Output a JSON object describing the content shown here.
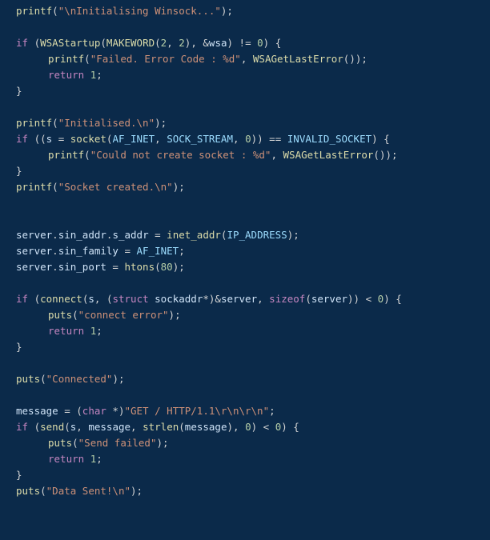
{
  "colors": {
    "background": "#0b2a4a",
    "keyword": "#c586c0",
    "function": "#dcdcaa",
    "macro": "#9cdcfe",
    "string": "#ce9178",
    "number": "#b5cea8",
    "identifier": "#cfe3f7",
    "punct": "#d4d4d4"
  },
  "t": {
    "printf": "printf",
    "if": "if",
    "return": "return",
    "return_sp": "return ",
    "sizeof": "sizeof",
    "struct": "struct",
    "char": "char",
    "puts": "puts",
    "WSAStartup": "WSAStartup",
    "MAKEWORD": "MAKEWORD",
    "WSAGetLastError": "WSAGetLastError",
    "socket": "socket",
    "AF_INET": "AF_INET",
    "SOCK_STREAM": "SOCK_STREAM",
    "INVALID_SOCKET": "INVALID_SOCKET",
    "inet_addr": "inet_addr",
    "IP_ADDRESS": "IP_ADDRESS",
    "htons": "htons",
    "connect": "connect",
    "sockaddr": " sockaddr",
    "send": "send",
    "strlen": "strlen",
    "wsa": "wsa",
    "s": "s",
    "server": "server",
    "message": "message",
    "sin_addr": "sin_addr",
    "s_addr": "s_addr",
    "sin_family": "sin_family",
    "sin_port": "sin_port",
    "str_init": "\"\\nInitialising Winsock...\"",
    "str_failcode": "\"Failed. Error Code : %d\"",
    "str_initialised": "\"Initialised.\\n\"",
    "str_couldnot": "\"Could not create socket : %d\"",
    "str_sockcreated": "\"Socket created.\\n\"",
    "str_connerr": "\"connect error\"",
    "str_connected": "\"Connected\"",
    "str_get": "\"GET / HTTP/1.1\\r\\n\\r\\n\"",
    "str_sendfail": "\"Send failed\"",
    "str_datasent": "\"Data Sent!\\n\"",
    "n0": "0",
    "n1": "1",
    "n2": "2",
    "n80": "80",
    "p_open": "(",
    "p_close": ")",
    "brace_open": " {",
    "brace_close": "}",
    "semi": ";",
    "comma": ", ",
    "amp": "&",
    "star": "*",
    "starcp": " *)",
    "neq0": " != ",
    "eqeq": " == ",
    "lt": " < ",
    "assign_eq": " = ",
    "dot": ".",
    "double_open": "((",
    "double_close": "))",
    "empty_call": "()",
    "cast_open": " (",
    "cast_close": ")",
    "ret_semi": ";"
  }
}
